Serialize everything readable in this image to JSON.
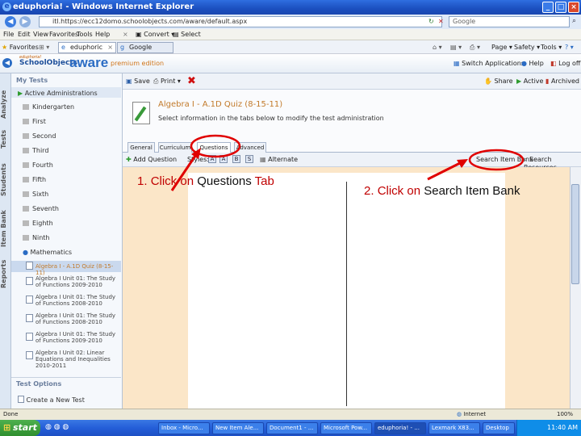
{
  "window": {
    "title": "eduphoria! - Windows Internet Explorer"
  },
  "browser": {
    "address": "itl.https://ecc12domo.schoolobjects.com/aware/default.aspx",
    "search_placeholder": "Google",
    "menu": [
      "File",
      "Edit",
      "View",
      "Favorites",
      "Tools",
      "Help"
    ],
    "convert_label": "Convert",
    "select_label": "Select",
    "favorites_label": "Favorites",
    "tabs": [
      "eduphoric",
      "Google"
    ],
    "toolbar_right": [
      "Page",
      "Safety",
      "Tools"
    ]
  },
  "app": {
    "logo_top": "eduphoria!",
    "logo_main": "SchoolObjects",
    "logo_aware": "aware",
    "logo_edition": "premium edition",
    "header_links": [
      "Switch Applications",
      "Help",
      "Log off"
    ]
  },
  "left_tabs": [
    "Analyze",
    "Tests",
    "Students",
    "Item Bank",
    "Reports"
  ],
  "sidebar": {
    "my_tests": "My Tests",
    "active_admin": "Active Administrations",
    "grades": [
      "Kindergarten",
      "First",
      "Second",
      "Third",
      "Fourth",
      "Fifth",
      "Sixth",
      "Seventh",
      "Eighth",
      "Ninth"
    ],
    "subject": "Mathematics",
    "selected_test": "Algebra I - A.1D Quiz (8-15-11)",
    "tests": [
      "Algebra I Unit 01: The Study of Functions 2009-2010",
      "Algebra I Unit 01: The Study of Functions 2008-2010",
      "Algebra I Unit 01: The Study of Functions 2008-2010",
      "Algebra I Unit 01: The Study of Functions 2009-2010",
      "Algebra I Unit 02: Linear Equations and Inequalities 2010-2011"
    ],
    "test_options": "Test Options",
    "create_test": "Create a New Test"
  },
  "toolbar": {
    "save": "Save",
    "print": "Print",
    "share": "Share",
    "active": "Active",
    "archived": "Archived"
  },
  "quiz": {
    "title": "Algebra I - A.1D Quiz (8-15-11)",
    "instructions": "Select information in the tabs below to modify the test administration",
    "tabs": [
      "General",
      "Curriculum",
      "Questions",
      "Advanced"
    ]
  },
  "question_toolbar": {
    "add_question": "Add Question",
    "styles_label": "Styles:",
    "style_buttons": [
      "A",
      "A",
      "B",
      "S"
    ],
    "alternate": "Alternate",
    "search_item_bank": "Search Item Bank",
    "search_resources": "Search Resources"
  },
  "callouts": {
    "c1_num": "1.",
    "c1_red1": "Click",
    "c1_on": "on",
    "c1_black": "Questions",
    "c1_red2": "Tab",
    "c2_num": "2.",
    "c2_red1": "Click",
    "c2_on": "on",
    "c2_black": "Search Item Bank"
  },
  "status": {
    "zone": "Internet",
    "zoom": "100%"
  },
  "taskbar": {
    "start": "start",
    "items": [
      "Inbox - Micro...",
      "New Item Ale...",
      "Document1 - ...",
      "Microsoft Pow...",
      "eduphoria! - ...",
      "Lexmark X83...",
      "Desktop"
    ],
    "clock": "11:40 AM"
  },
  "colors": {
    "highlight_ring": "#e00000",
    "content_bg": "#fbe6c8",
    "accent": "#2b6cc4"
  }
}
